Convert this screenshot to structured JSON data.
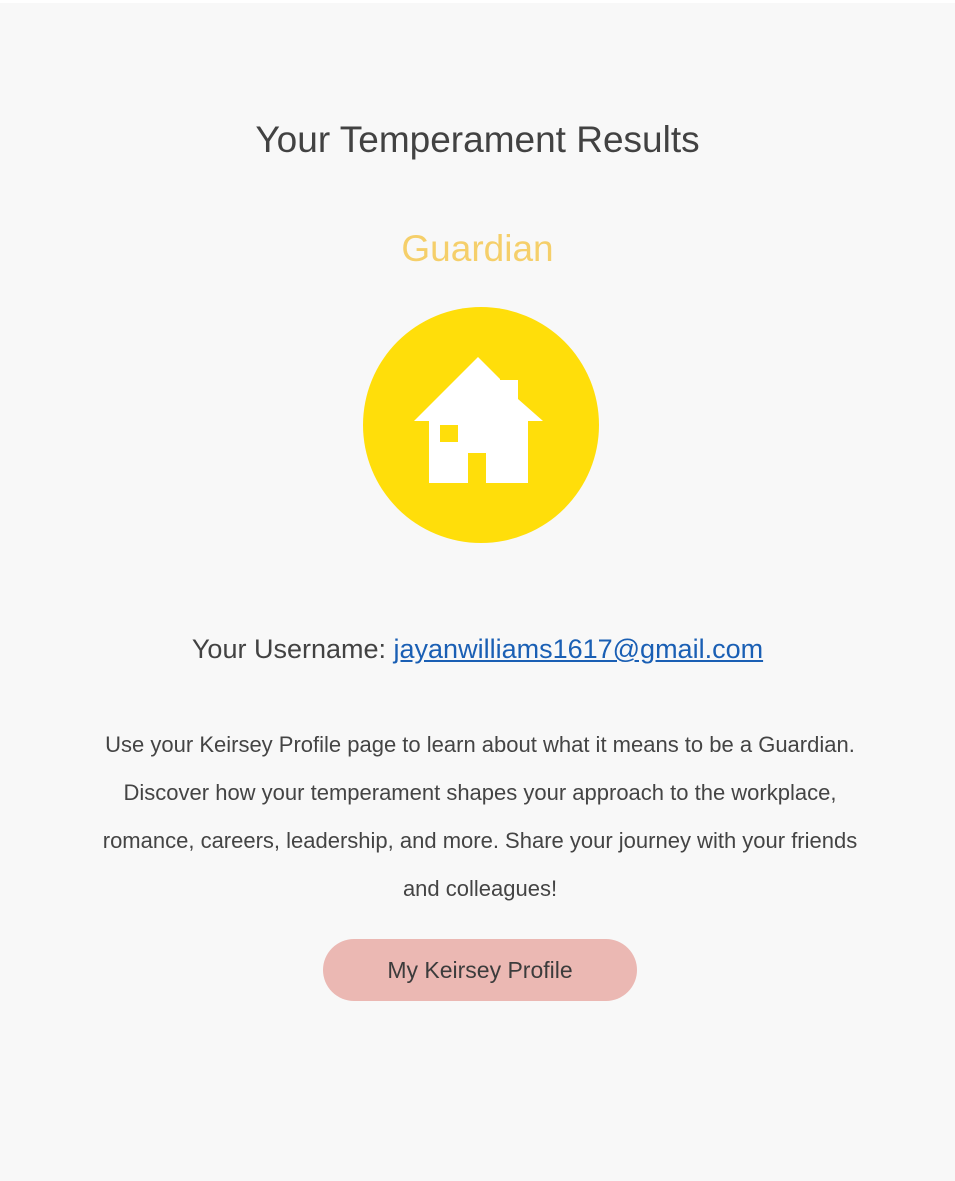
{
  "results": {
    "heading": "Your Temperament Results",
    "temperament": "Guardian",
    "temperament_color": "#f5cf6a",
    "badge_icon": "house-icon",
    "badge_color": "#ffde0a"
  },
  "account": {
    "username_label": "Your Username:",
    "username": "jayanwilliams1617@gmail.com"
  },
  "description": "Use your Keirsey Profile page to learn about what it means to be a Guardian. Discover how your temperament shapes your approach to the workplace, romance, careers, leadership, and more. Share your journey with your friends and colleagues!",
  "cta": {
    "label": "My Keirsey Profile",
    "color": "#ebb8b3"
  }
}
